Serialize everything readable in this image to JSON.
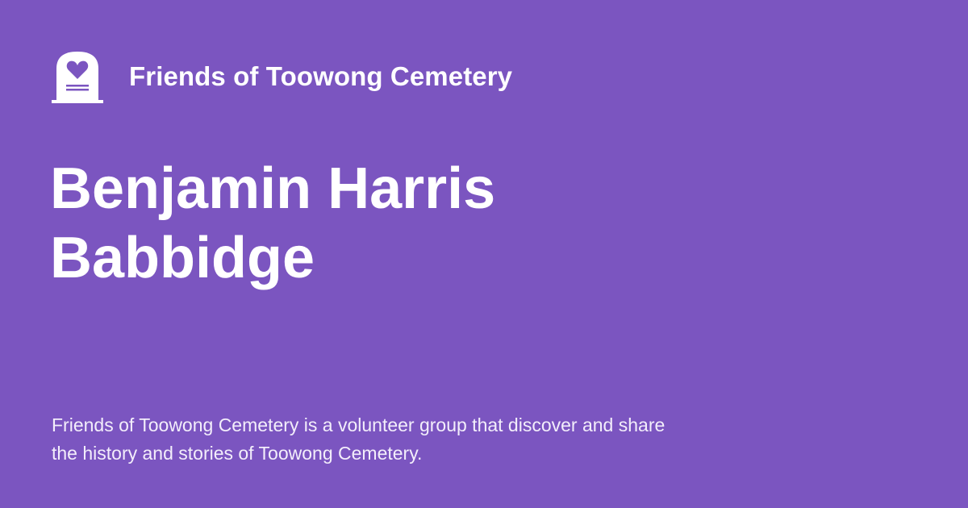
{
  "brand": {
    "name": "Friends of Toowong Cemetery",
    "logo_icon": "headstone-heart-icon"
  },
  "page": {
    "title": "Benjamin Harris Babbidge",
    "description": "Friends of Toowong Cemetery is a volunteer group that discover and share the history and stories of Toowong Cemetery."
  },
  "colors": {
    "background": "#7b55c0",
    "text": "#ffffff",
    "description_text": "#f3eefb"
  }
}
